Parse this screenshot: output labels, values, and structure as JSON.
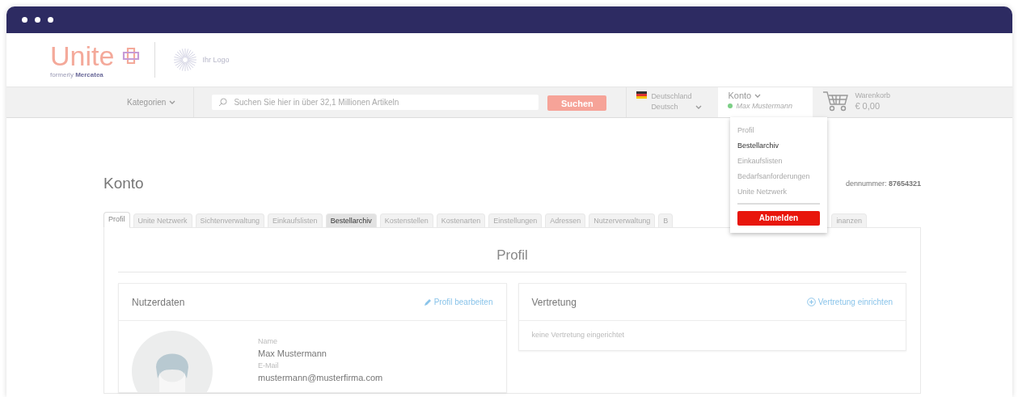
{
  "header": {
    "logo": {
      "name": "Unite",
      "tagline": "formerly **Mercatea**"
    },
    "partner_logo": "Ihr Logo"
  },
  "nav": {
    "categories": "Kategorien",
    "search": {
      "placeholder": "Suchen Sie hier in über 32,1 Millionen Artikeln"
    },
    "search_button": "Suchen",
    "region": {
      "country": "Deutschland",
      "language": "Deutsch"
    },
    "account": {
      "label": "Konto",
      "user": "Max Mustermann",
      "online": true,
      "expanded": true
    },
    "cart": {
      "label": "Warenkorb",
      "total": "€ 0,00"
    }
  },
  "account_menu": {
    "items": [
      {
        "label": "Profil",
        "hovered": false
      },
      {
        "label": "Bestellarchiv",
        "hovered": true
      },
      {
        "label": "Einkaufslisten",
        "hovered": false
      },
      {
        "label": "Bedarfsanforderungen",
        "hovered": false
      },
      {
        "label": "Unite Netzwerk",
        "hovered": false
      }
    ],
    "logout": "Abmelden"
  },
  "page": {
    "title": "Konto",
    "customer_number": "dennummer: **87654321**",
    "tabs": [
      {
        "label": "Profil",
        "selected": true,
        "hovered": false
      },
      {
        "label": "Unite Netzwerk",
        "selected": false,
        "hovered": false
      },
      {
        "label": "Sichtenverwaltung",
        "selected": false,
        "hovered": false
      },
      {
        "label": "Einkaufslisten",
        "selected": false,
        "hovered": false
      },
      {
        "label": "Bestellarchiv",
        "selected": false,
        "hovered": true
      },
      {
        "label": "Kostenstellen",
        "selected": false,
        "hovered": false
      },
      {
        "label": "Kostenarten",
        "selected": false,
        "hovered": false
      },
      {
        "label": "Einstellungen",
        "selected": false,
        "hovered": false
      },
      {
        "label": "Adressen",
        "selected": false,
        "hovered": false
      },
      {
        "label": "Nutzerverwaltung",
        "selected": false,
        "hovered": false
      },
      {
        "label": "B",
        "selected": false,
        "hovered": false
      },
      {
        "label": "inanzen",
        "selected": false,
        "hovered": false
      }
    ],
    "panel_title": "Profil",
    "user_card": {
      "title": "Nutzerdaten",
      "action": "Profil bearbeiten",
      "fields": [
        {
          "label": "Name",
          "value": "Max Mustermann"
        },
        {
          "label": "E-Mail",
          "value": "mustermann@musterfirma.com"
        }
      ]
    },
    "deputy_card": {
      "title": "Vertretung",
      "action": "Vertretung einrichten",
      "empty_text": "keine Vertretung eingerichtet"
    }
  }
}
